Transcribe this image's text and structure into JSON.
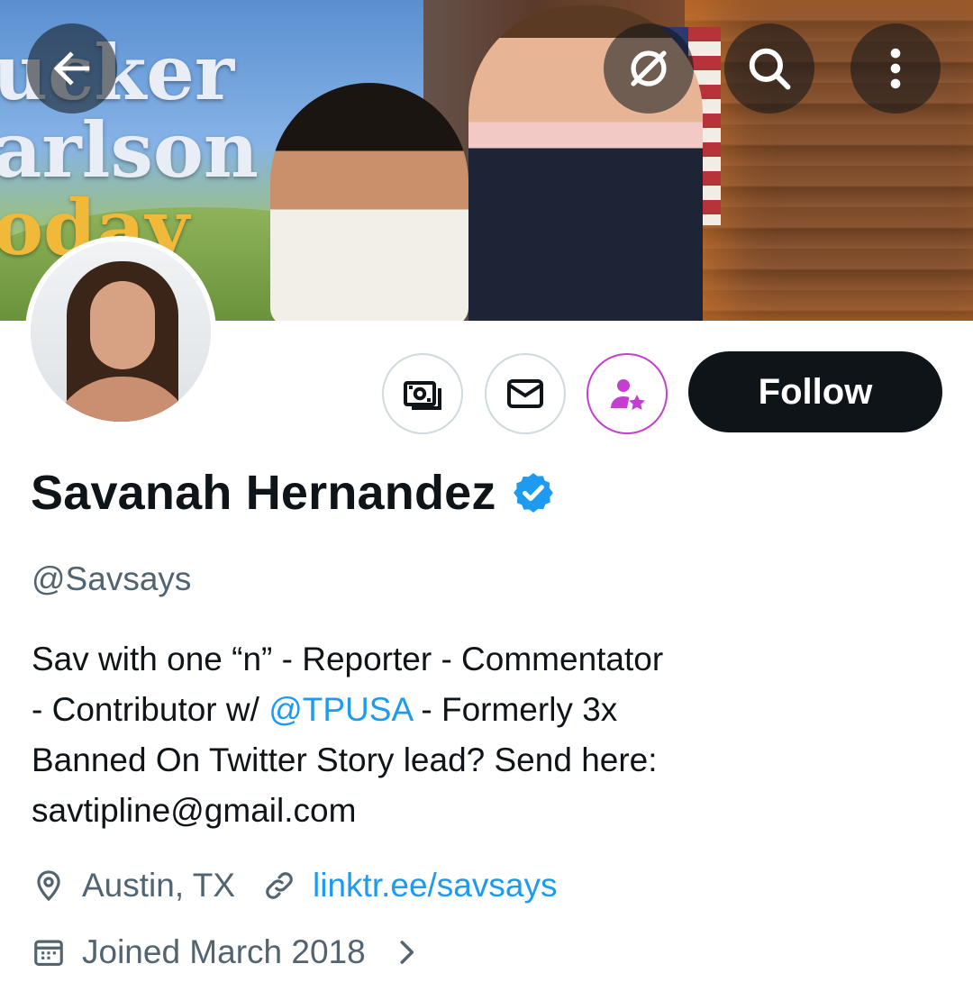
{
  "banner": {
    "show_title_line1": "ucker",
    "show_title_line2": "arlson",
    "show_title_line3": "oday"
  },
  "profile": {
    "name": "Savanah Hernandez",
    "handle": "@Savsays",
    "verified": true,
    "bio": {
      "part1": "Sav with one “n” - Reporter - Commentator",
      "part2": "- Contributor w/ ",
      "mention": "@TPUSA",
      "part3": " - Formerly 3x",
      "part4": "Banned On Twitter  Story lead? Send here:",
      "part5": "savtipline@gmail.com"
    },
    "location": "Austin, TX",
    "website": "linktr.ee/savsays",
    "joined": "Joined March 2018"
  },
  "actions": {
    "follow_label": "Follow"
  },
  "icons": {
    "back": "back-arrow-icon",
    "grok": "grok-icon",
    "search": "search-icon",
    "more": "more-vertical-icon",
    "tip": "tip-money-icon",
    "message": "envelope-icon",
    "subscribe": "subscribe-person-star-icon",
    "verified": "verified-badge-icon",
    "location": "location-pin-icon",
    "link": "link-icon",
    "calendar": "calendar-icon",
    "chevron": "chevron-right-icon"
  },
  "colors": {
    "accent_blue": "#1d9bf0",
    "subscribe_purple": "#c43fcf",
    "follow_bg": "#0f1419",
    "secondary_text": "#536471"
  }
}
